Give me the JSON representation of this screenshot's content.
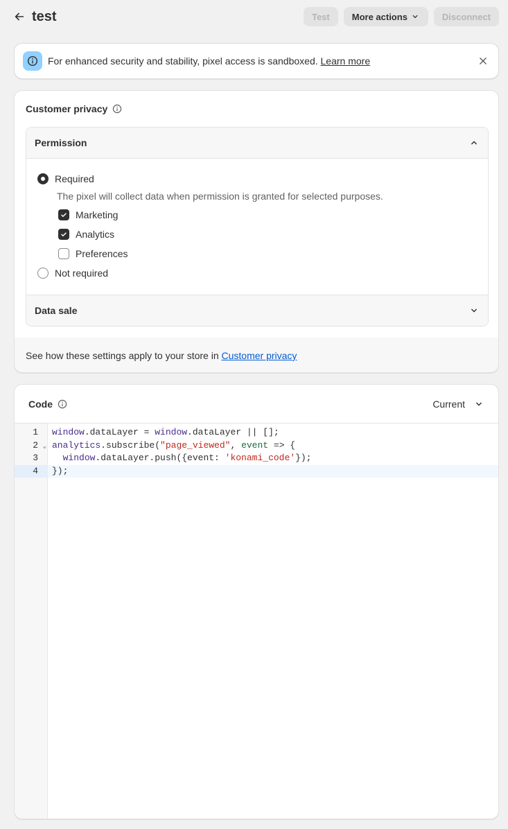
{
  "header": {
    "title": "test",
    "test_label": "Test",
    "more_actions_label": "More actions",
    "disconnect_label": "Disconnect"
  },
  "banner": {
    "text": "For enhanced security and stability, pixel access is sandboxed.",
    "link": "Learn more"
  },
  "privacy": {
    "title": "Customer privacy",
    "permission_title": "Permission",
    "required_label": "Required",
    "required_help": "The pixel will collect data when permission is granted for selected purposes.",
    "purposes": [
      {
        "label": "Marketing",
        "checked": true
      },
      {
        "label": "Analytics",
        "checked": true
      },
      {
        "label": "Preferences",
        "checked": false
      }
    ],
    "not_required_label": "Not required",
    "data_sale_title": "Data sale",
    "footer_text": "See how these settings apply to your store in",
    "footer_link": "Customer privacy"
  },
  "code": {
    "title": "Code",
    "version": "Current",
    "lines": [
      {
        "num": "1",
        "tokens": [
          [
            "var",
            "window"
          ],
          [
            "plain",
            ".dataLayer = "
          ],
          [
            "var",
            "window"
          ],
          [
            "plain",
            ".dataLayer || [];"
          ]
        ]
      },
      {
        "num": "2",
        "fold": true,
        "tokens": [
          [
            "var",
            "analytics"
          ],
          [
            "plain",
            ".subscribe("
          ],
          [
            "str",
            "\"page_viewed\""
          ],
          [
            "plain",
            ", "
          ],
          [
            "param",
            "event"
          ],
          [
            "plain",
            " => {"
          ]
        ]
      },
      {
        "num": "3",
        "tokens": [
          [
            "plain",
            "  "
          ],
          [
            "var",
            "window"
          ],
          [
            "plain",
            ".dataLayer.push({event: "
          ],
          [
            "str",
            "'konami_code'"
          ],
          [
            "plain",
            "});"
          ]
        ]
      },
      {
        "num": "4",
        "active": true,
        "tokens": [
          [
            "plain",
            "});"
          ]
        ]
      }
    ]
  },
  "colors": {
    "accent_link": "#005bd3",
    "info_badge": "#91d0ff",
    "token_var": "#4a2d8a",
    "token_string": "#c4271b",
    "token_param": "#1d6b42"
  },
  "icons": {
    "back": "arrow-left-icon",
    "info": "info-icon",
    "close": "close-icon",
    "chevron_up": "chevron-up-icon",
    "chevron_down": "chevron-down-icon",
    "check": "checkmark-icon"
  }
}
